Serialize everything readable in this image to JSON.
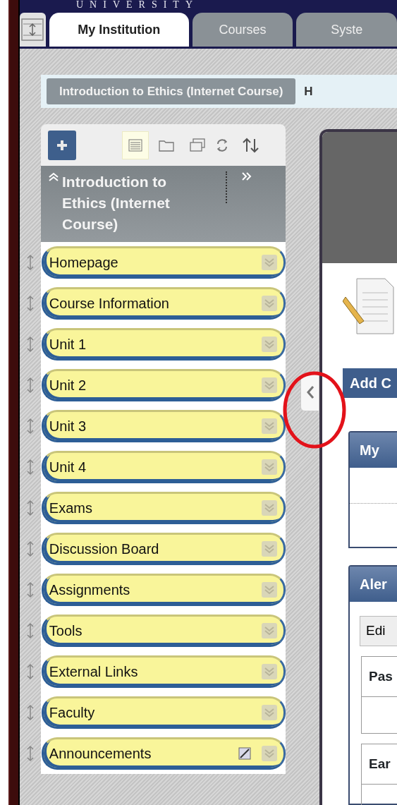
{
  "header": {
    "logo_text": "UNIVERSITY"
  },
  "tabs": [
    {
      "label": "My Institution",
      "selected": true
    },
    {
      "label": "Courses",
      "selected": false
    },
    {
      "label": "Syste",
      "selected": false
    }
  ],
  "breadcrumbs": [
    {
      "label": "Introduction to Ethics (Internet Course)",
      "selected": true
    },
    {
      "label": "H",
      "selected": false
    }
  ],
  "course_menu": {
    "view_buttons": [
      {
        "kind": "list",
        "selected": true
      },
      {
        "kind": "folder",
        "selected": false
      },
      {
        "kind": "window",
        "selected": false
      }
    ],
    "title": "Introduction to Ethics (Internet Course)",
    "items": [
      {
        "label": "Homepage",
        "hidden": false
      },
      {
        "label": "Course Information",
        "hidden": false
      },
      {
        "label": "Unit 1",
        "hidden": false
      },
      {
        "label": "Unit 2",
        "hidden": false
      },
      {
        "label": "Unit 3",
        "hidden": false
      },
      {
        "label": "Unit 4",
        "hidden": false
      },
      {
        "label": "Exams",
        "hidden": false
      },
      {
        "label": "Discussion Board",
        "hidden": false
      },
      {
        "label": "Assignments",
        "hidden": false
      },
      {
        "label": "Tools",
        "hidden": false
      },
      {
        "label": "External Links",
        "hidden": false
      },
      {
        "label": "Faculty",
        "hidden": false
      },
      {
        "label": "Announcements",
        "hidden": true
      }
    ]
  },
  "content": {
    "action_bar": "Add C",
    "modules": [
      {
        "title": "My"
      },
      {
        "title": "Aler",
        "button": "Edi",
        "sections": [
          "Pas",
          "Ear"
        ]
      }
    ]
  }
}
